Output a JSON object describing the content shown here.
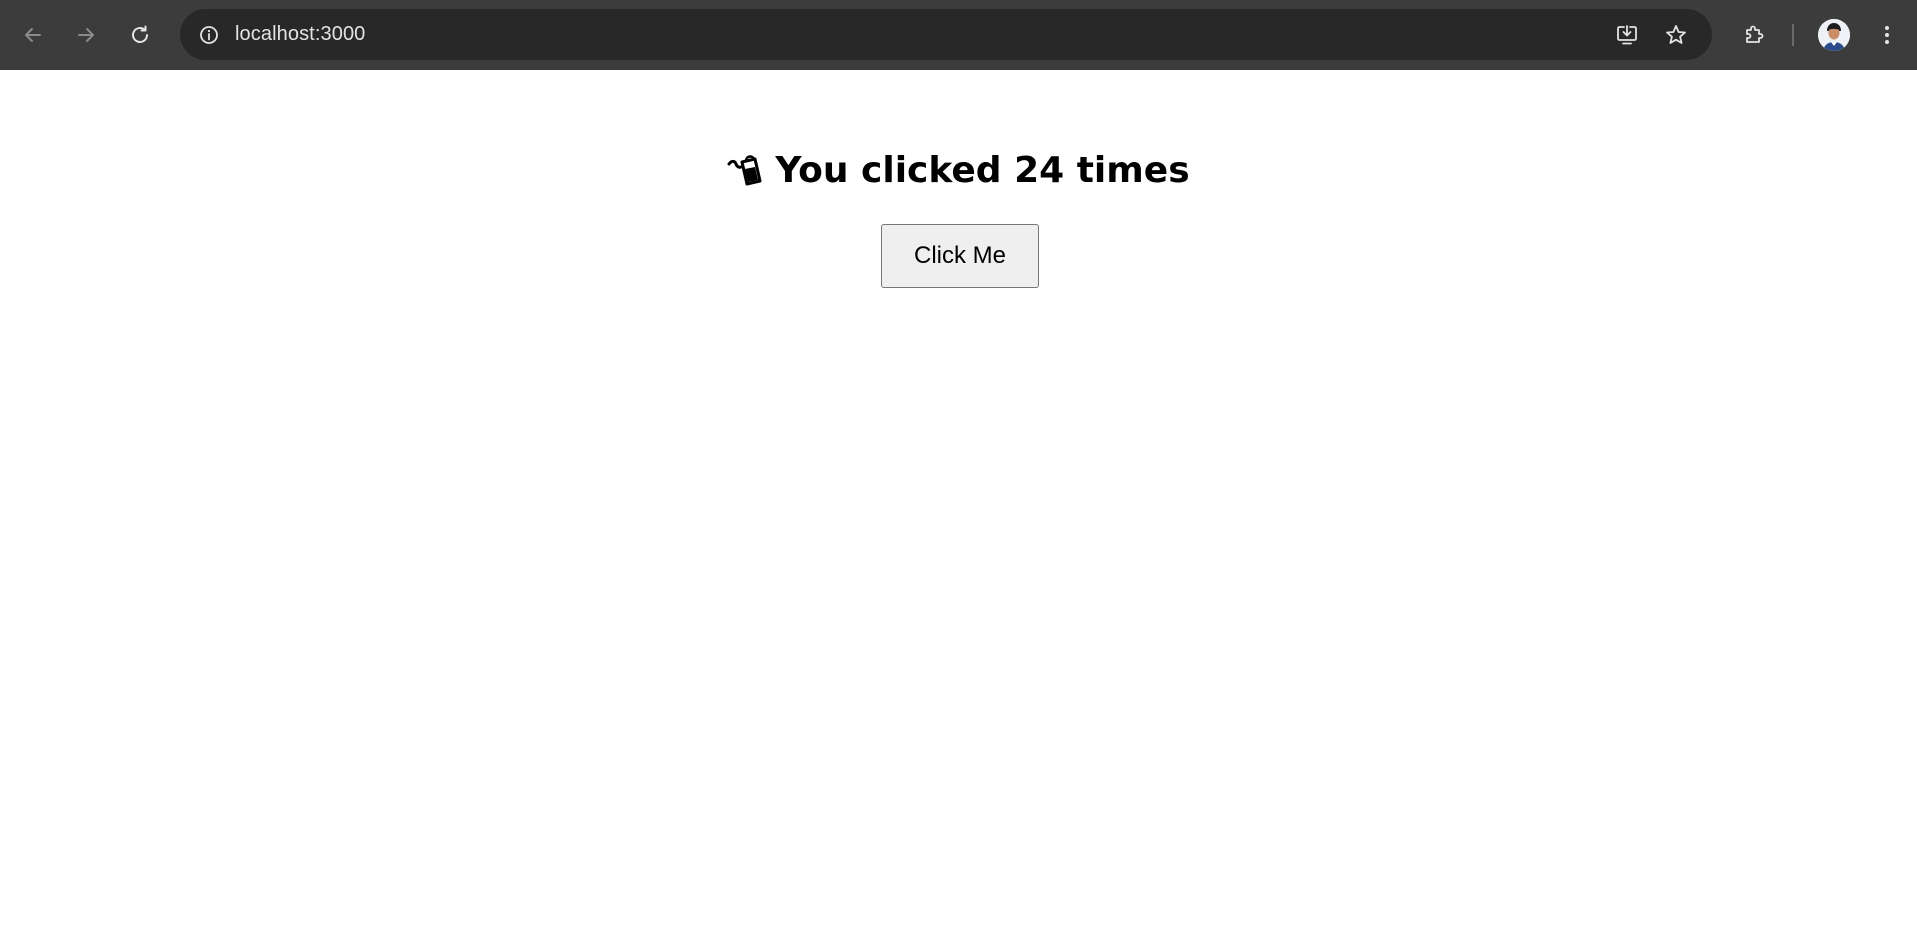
{
  "browser": {
    "url": "localhost:3000",
    "icons": {
      "back": "arrow-left-icon",
      "forward": "arrow-right-icon",
      "reload": "reload-icon",
      "site_info": "info-icon",
      "install": "install-app-icon",
      "bookmark": "star-icon",
      "extensions": "puzzle-icon",
      "profile": "avatar",
      "menu": "kebab-menu-icon"
    },
    "colors": {
      "toolbar": "#3c3c3c",
      "omnibox": "#282828",
      "icon": "#e3e3e3",
      "icon_disabled": "#8a8a8a"
    }
  },
  "page": {
    "heading": "You clicked 24 times",
    "heading_icon": "shopping-bag-icon",
    "button_label": "Click Me"
  }
}
